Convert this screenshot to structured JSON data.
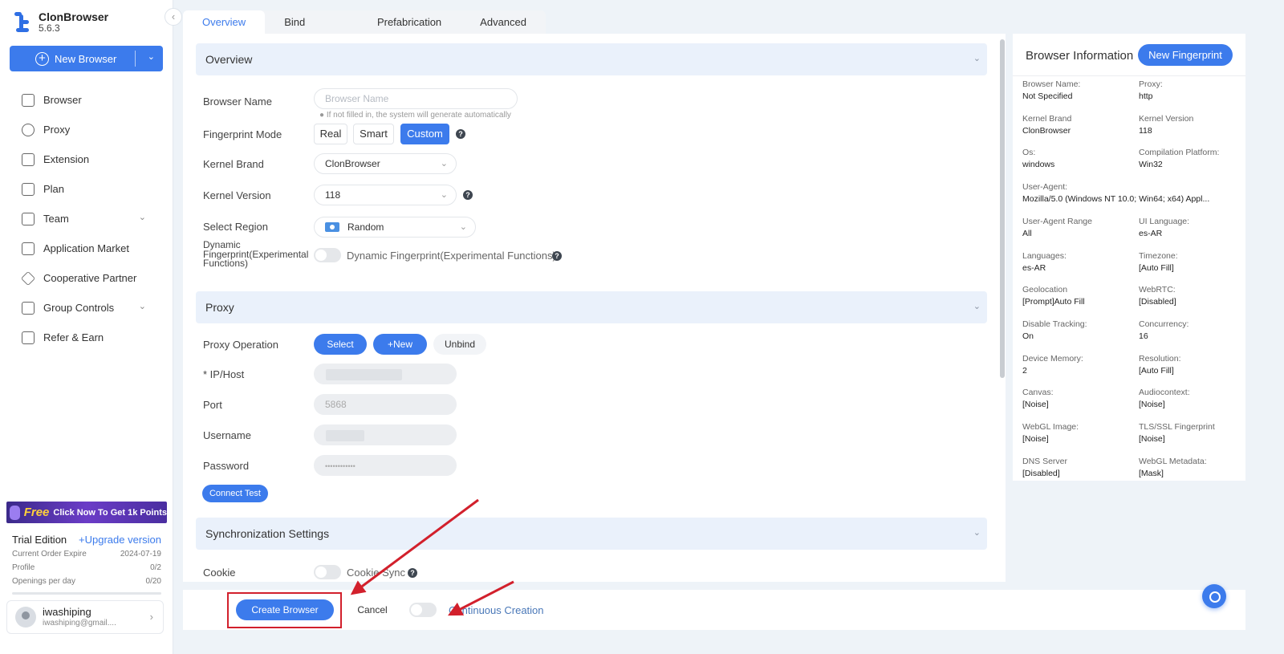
{
  "app": {
    "name": "ClonBrowser",
    "version": "5.6.3"
  },
  "sidebar": {
    "collapse_icon": "chevron-left-icon",
    "new_browser_label": "New Browser",
    "nav": [
      {
        "label": "Browser",
        "icon": "browser-icon"
      },
      {
        "label": "Proxy",
        "icon": "globe-icon"
      },
      {
        "label": "Extension",
        "icon": "puzzle-icon"
      },
      {
        "label": "Plan",
        "icon": "document-icon"
      },
      {
        "label": "Team",
        "icon": "team-icon",
        "expandable": true
      },
      {
        "label": "Application Market",
        "icon": "cube-icon"
      },
      {
        "label": "Cooperative Partner",
        "icon": "diamond-icon"
      },
      {
        "label": "Group Controls",
        "icon": "group-icon",
        "expandable": true
      },
      {
        "label": "Refer & Earn",
        "icon": "gift-icon"
      }
    ],
    "promo": {
      "free": "Free",
      "text": "Click Now To Get 1k Points"
    },
    "trial": {
      "title": "Trial Edition",
      "upgrade": "+Upgrade version",
      "rows": [
        {
          "k": "Current Order Expire",
          "v": "2024-07-19"
        },
        {
          "k": "Profile",
          "v": "0/2"
        },
        {
          "k": "Openings per day",
          "v": "0/20"
        }
      ]
    },
    "user": {
      "name": "iwashiping",
      "email": "iwashiping@gmail...."
    }
  },
  "tabs": [
    "Overview",
    "Bind Account",
    "Prefabrication",
    "Advanced"
  ],
  "overview": {
    "title": "Overview",
    "browser_name_label": "Browser Name",
    "browser_name_placeholder": "Browser Name",
    "browser_name_hint": "If not filled in, the system will generate automatically",
    "fingerprint_mode_label": "Fingerprint Mode",
    "fingerprint_modes": [
      "Real",
      "Smart",
      "Custom"
    ],
    "fingerprint_mode_selected": "Custom",
    "kernel_brand_label": "Kernel Brand",
    "kernel_brand_value": "ClonBrowser",
    "kernel_version_label": "Kernel Version",
    "kernel_version_value": "118",
    "region_label": "Select Region",
    "region_value": "Random",
    "dynamic_label": "Dynamic Fingerprint(Experimental Functions)",
    "dynamic_toggle_label": "Dynamic Fingerprint(Experimental Functions)"
  },
  "proxy": {
    "title": "Proxy",
    "operation_label": "Proxy Operation",
    "select_label": "Select",
    "new_label": "+New",
    "unbind_label": "Unbind",
    "ip_label": "* IP/Host",
    "port_label": "Port",
    "port_value": "5868",
    "username_label": "Username",
    "password_label": "Password",
    "password_value": "••••••••••••",
    "connect_test_label": "Connect Test"
  },
  "sync": {
    "title": "Synchronization Settings",
    "cookie_label": "Cookie",
    "cookie_sync_label": "Cookie Sync"
  },
  "footer": {
    "create_label": "Create Browser",
    "cancel_label": "Cancel",
    "continuous_label": "Continuous Creation"
  },
  "info": {
    "title": "Browser Information",
    "new_fingerprint_label": "New Fingerprint",
    "items": [
      {
        "k": "Browser Name:",
        "v": "Not Specified"
      },
      {
        "k": "Proxy:",
        "v": "http"
      },
      {
        "k": "Kernel Brand",
        "v": "ClonBrowser"
      },
      {
        "k": "Kernel Version",
        "v": "118"
      },
      {
        "k": "Os:",
        "v": "windows"
      },
      {
        "k": "Compilation Platform:",
        "v": "Win32"
      },
      {
        "k": "User-Agent:",
        "v": "Mozilla/5.0 (Windows NT 10.0; Win64; x64) Appl..."
      },
      {
        "k": "",
        "v": ""
      },
      {
        "k": "User-Agent Range",
        "v": "All"
      },
      {
        "k": "UI Language:",
        "v": "es-AR"
      },
      {
        "k": "Languages:",
        "v": "es-AR"
      },
      {
        "k": "Timezone:",
        "v": "[Auto Fill]"
      },
      {
        "k": "Geolocation",
        "v": "[Prompt]Auto Fill"
      },
      {
        "k": "WebRTC:",
        "v": "[Disabled]"
      },
      {
        "k": "Disable Tracking:",
        "v": "On"
      },
      {
        "k": "Concurrency:",
        "v": "16"
      },
      {
        "k": "Device Memory:",
        "v": "2"
      },
      {
        "k": "Resolution:",
        "v": "[Auto Fill]"
      },
      {
        "k": "Canvas:",
        "v": "[Noise]"
      },
      {
        "k": "Audiocontext:",
        "v": "[Noise]"
      },
      {
        "k": "WebGL Image:",
        "v": "[Noise]"
      },
      {
        "k": "TLS/SSL Fingerprint",
        "v": "[Noise]"
      },
      {
        "k": "DNS Server",
        "v": "[Disabled]"
      },
      {
        "k": "WebGL Metadata:",
        "v": "[Mask]"
      }
    ]
  },
  "colors": {
    "accent": "#3c7bec",
    "section_bg": "#eaf1fb",
    "highlight": "#d2202c"
  }
}
